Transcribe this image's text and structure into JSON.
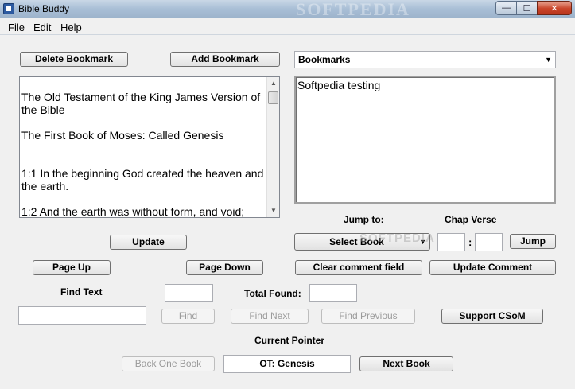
{
  "window": {
    "title": "Bible Buddy",
    "watermark": "SOFTPEDIA"
  },
  "menu": [
    "File",
    "Edit",
    "Help"
  ],
  "buttons": {
    "delete_bookmark": "Delete Bookmark",
    "add_bookmark": "Add Bookmark",
    "update": "Update",
    "select_book": "Select Book",
    "jump": "Jump",
    "page_up": "Page Up",
    "page_down": "Page Down",
    "clear_comment": "Clear comment field",
    "update_comment": "Update Comment",
    "find": "Find",
    "find_next": "Find Next",
    "find_previous": "Find Previous",
    "support": "Support CSoM",
    "back_one_book": "Back One Book",
    "next_book": "Next Book"
  },
  "bookmarks_select": {
    "value": "Bookmarks"
  },
  "bible_text": [
    "The Old Testament of the King James Version of the Bible",
    "The First Book of Moses:  Called Genesis",
    "1:1 In the beginning God created the heaven and the earth.",
    "1:2 And the earth was without form, and void;"
  ],
  "comment": "Softpedia testing",
  "labels": {
    "jump_to": "Jump to:",
    "chap_verse": "Chap  Verse",
    "colon": ":",
    "find_text": "Find Text",
    "total_found": "Total Found:",
    "current_pointer": "Current Pointer"
  },
  "fields": {
    "chapter": "",
    "verse": "",
    "find_count": "",
    "total_found": "",
    "find_text": "",
    "current_pointer": "OT: Genesis"
  },
  "page_watermark": "SOFTPEDIA"
}
